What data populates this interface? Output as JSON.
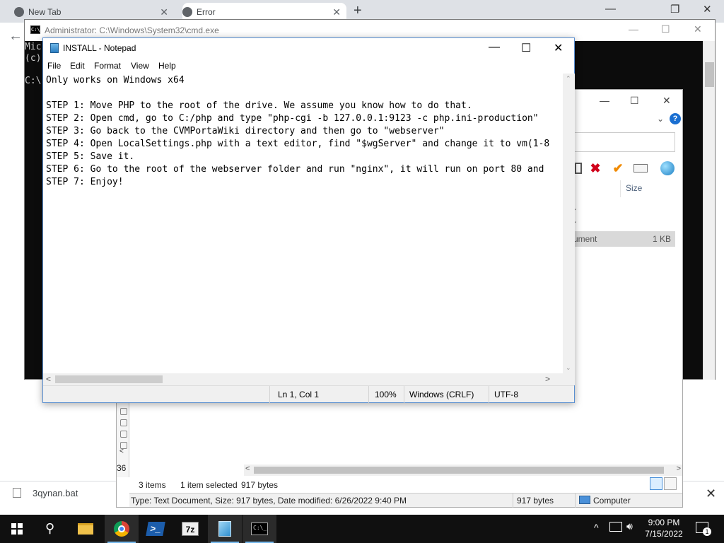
{
  "browser": {
    "tabs": [
      {
        "label": "New Tab",
        "close": "✕"
      },
      {
        "label": "Error",
        "close": "✕"
      }
    ],
    "new_tab": "+",
    "back": "←",
    "minimize": "—",
    "restore": "❐",
    "close": "✕"
  },
  "downloads": {
    "file_name": "3qynan.bat",
    "close": "✕"
  },
  "cmd": {
    "title": "Administrator: C:\\Windows\\System32\\cmd.exe",
    "icon_text": "C:\\",
    "lines": [
      "Mic",
      "(c)",
      "",
      "C:\\"
    ],
    "minimize": "—",
    "maximize": "☐",
    "close": "✕"
  },
  "explorer": {
    "column_size": "Size",
    "rows": [
      {
        "name": "r"
      },
      {
        "name": "r"
      }
    ],
    "selected_row": {
      "name": "ument",
      "size": "1 KB"
    },
    "nav_count": "36",
    "status": {
      "items": "3 items",
      "selected": "1 item selected",
      "bytes": "917 bytes"
    },
    "info": {
      "details": "Type: Text Document, Size: 917 bytes, Date modified: 6/26/2022 9:40 PM",
      "size": "917 bytes",
      "location": "Computer"
    },
    "minimize": "—",
    "maximize": "☐",
    "close": "✕",
    "chevron": "⌄",
    "help": "?",
    "scroll_left": "<",
    "scroll_right": ">"
  },
  "notepad": {
    "title": "INSTALL - Notepad",
    "menu": [
      "File",
      "Edit",
      "Format",
      "View",
      "Help"
    ],
    "content": [
      "Only works on Windows x64",
      "",
      "STEP 1: Move PHP to the root of the drive. We assume you know how to do that.",
      "STEP 2: Open cmd, go to C:/php and type \"php-cgi -b 127.0.0.1:9123 -c php.ini-production\"",
      "STEP 3: Go back to the CVMPortaWiki directory and then go to \"webserver\"",
      "STEP 4: Open LocalSettings.php with a text editor, find \"$wgServer\" and change it to vm(1-8",
      "STEP 5: Save it.",
      "STEP 6: Go to the root of the webserver folder and run \"nginx\", it will run on port 80 and",
      "STEP 7: Enjoy!"
    ],
    "status": {
      "position": "Ln 1, Col 1",
      "zoom": "100%",
      "line_ending": "Windows (CRLF)",
      "encoding": "UTF-8"
    },
    "minimize": "—",
    "maximize": "☐",
    "close": "✕",
    "scroll_left": "<",
    "scroll_right": ">",
    "scroll_up": "⌃",
    "scroll_down": "⌄"
  },
  "taskbar": {
    "search_glyph": "⚲",
    "zip_label": "7z",
    "cmd_icon_text": "C:\\_",
    "tray_chevron": "^",
    "time": "9:00 PM",
    "date": "7/15/2022",
    "notification_count": "1",
    "icons": [
      "windows-start-icon",
      "search-icon",
      "file-explorer-icon",
      "chrome-icon",
      "powershell-icon",
      "7zip-icon",
      "notepad-icon",
      "cmd-icon"
    ]
  }
}
